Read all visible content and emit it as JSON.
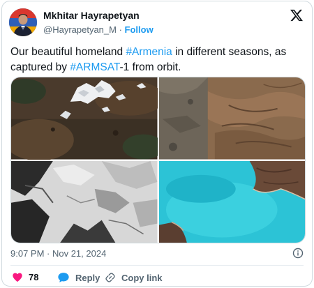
{
  "author": {
    "display_name": "Mkhitar Hayrapetyan",
    "handle": "@Hayrapetyan_M",
    "separator": " · ",
    "follow_label": "Follow"
  },
  "tweet": {
    "text_parts": [
      "Our beautiful homeland ",
      "#Armenia",
      " in different seasons, as captured by ",
      "#ARMSAT",
      "-1 from orbit."
    ]
  },
  "media": {
    "photos": [
      "mountain-snow-patches",
      "arid-terrain-and-city",
      "snow-covered-mountains",
      "turquoise-lake-shoreline"
    ]
  },
  "meta": {
    "timestamp": "9:07 PM · Nov 21, 2024"
  },
  "actions": {
    "likes_count": "78",
    "reply_label": "Reply",
    "copy_link_label": "Copy link"
  },
  "colors": {
    "link": "#1d9bf0",
    "like": "#f91880",
    "muted": "#536471",
    "border": "#cfd9de"
  }
}
